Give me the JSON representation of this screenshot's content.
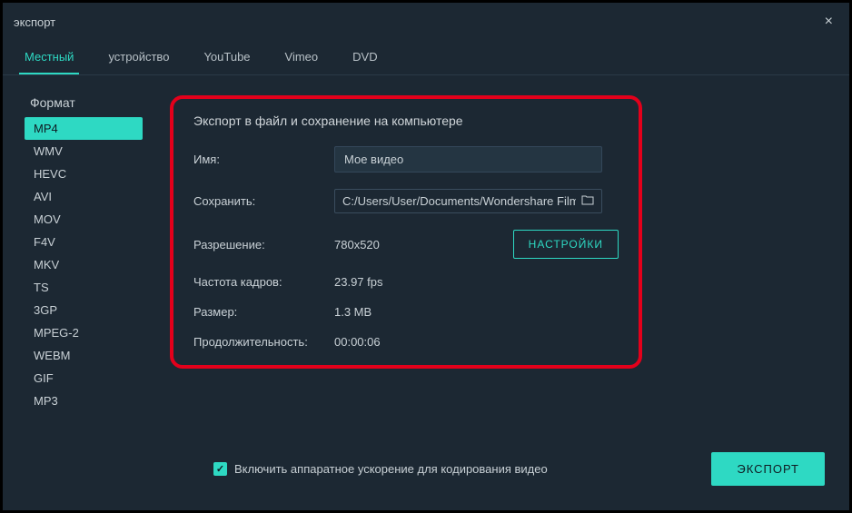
{
  "window": {
    "title": "экспорт"
  },
  "tabs": [
    {
      "label": "Местный",
      "active": true
    },
    {
      "label": "устройство"
    },
    {
      "label": "YouTube"
    },
    {
      "label": "Vimeo"
    },
    {
      "label": "DVD"
    }
  ],
  "sidebar": {
    "header": "Формат",
    "items": [
      {
        "label": "MP4",
        "active": true
      },
      {
        "label": "WMV"
      },
      {
        "label": "HEVC"
      },
      {
        "label": "AVI"
      },
      {
        "label": "MOV"
      },
      {
        "label": "F4V"
      },
      {
        "label": "MKV"
      },
      {
        "label": "TS"
      },
      {
        "label": "3GP"
      },
      {
        "label": "MPEG-2"
      },
      {
        "label": "WEBM"
      },
      {
        "label": "GIF"
      },
      {
        "label": "MP3"
      }
    ]
  },
  "panel": {
    "title": "Экспорт в файл и сохранение на компьютере",
    "name_label": "Имя:",
    "name_value": "Мое видео",
    "save_label": "Сохранить:",
    "save_path": "C:/Users/User/Documents/Wondershare Filmora",
    "resolution_label": "Разрешение:",
    "resolution_value": "780x520",
    "settings_btn": "НАСТРОЙКИ",
    "fps_label": "Частота кадров:",
    "fps_value": "23.97 fps",
    "size_label": "Размер:",
    "size_value": "1.3 MB",
    "duration_label": "Продолжительность:",
    "duration_value": "00:00:06"
  },
  "footer": {
    "hw_accel_label": "Включить аппаратное ускорение для кодирования видео",
    "hw_accel_checked": true,
    "export_btn": "ЭКСПОРТ"
  }
}
